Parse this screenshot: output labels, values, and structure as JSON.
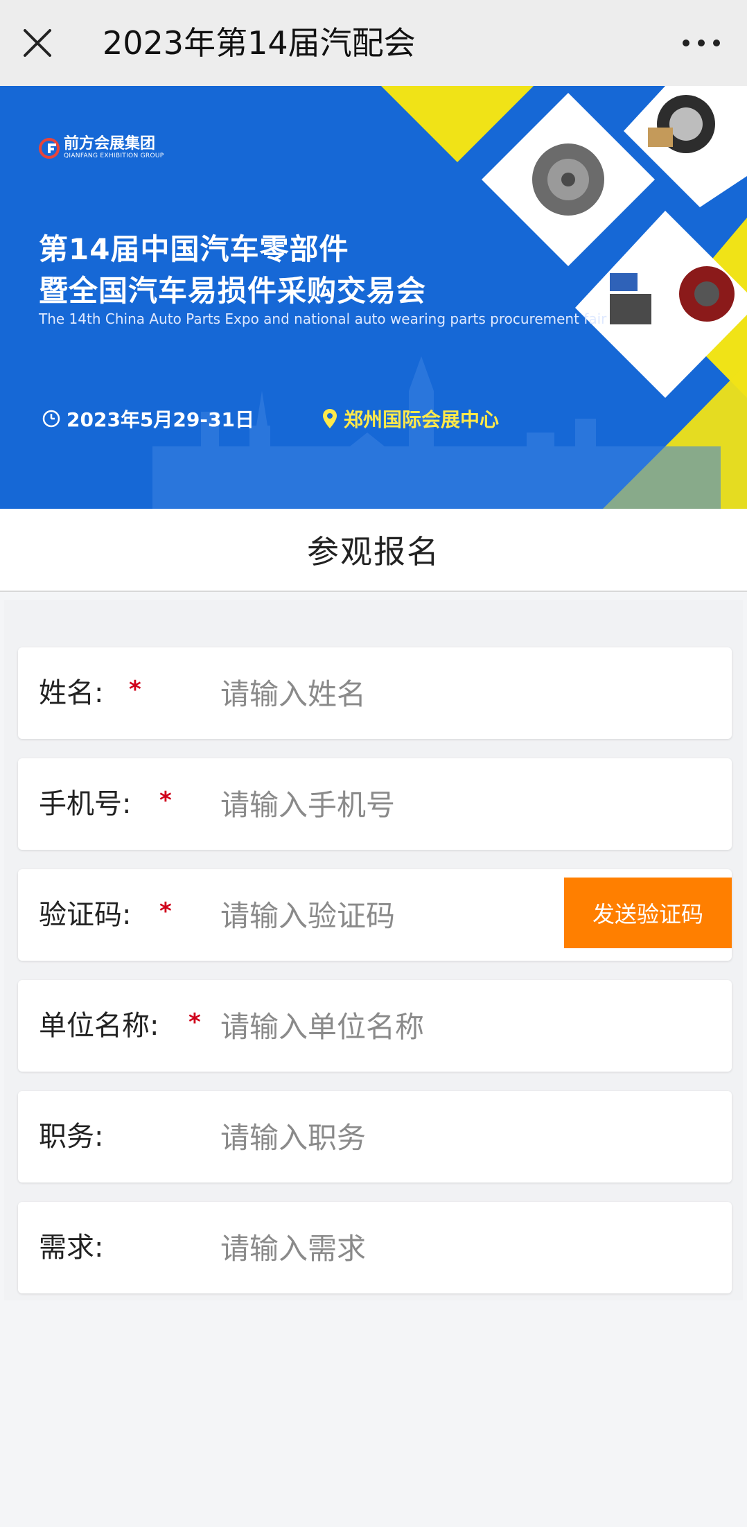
{
  "topbar": {
    "title": "2023年第14届汽配会",
    "close_icon": "close-icon",
    "more_icon": "more-dots-icon"
  },
  "banner": {
    "logo_cn": "前方会展集团",
    "logo_en": "QIANFANG EXHIBITION GROUP",
    "title_line1": "第14届中国汽车零部件",
    "title_line2": "暨全国汽车易损件采购交易会",
    "subtitle": "The 14th China Auto Parts Expo and national auto wearing parts procurement fair",
    "date": "2023年5月29-31日",
    "location": "郑州国际会展中心",
    "colors": {
      "background": "#1668d6",
      "accent_yellow": "#f0e317",
      "location_text": "#ffe94a"
    }
  },
  "section": {
    "title": "参观报名"
  },
  "form": {
    "fields": [
      {
        "label": "姓名:",
        "required": true,
        "placeholder": "请输入姓名"
      },
      {
        "label": "手机号:",
        "required": true,
        "placeholder": "请输入手机号"
      },
      {
        "label": "验证码:",
        "required": true,
        "placeholder": "请输入验证码"
      },
      {
        "label": "单位名称:",
        "required": true,
        "placeholder": "请输入单位名称"
      },
      {
        "label": "职务:",
        "required": false,
        "placeholder": "请输入职务"
      },
      {
        "label": "需求:",
        "required": false,
        "placeholder": "请输入需求"
      }
    ],
    "required_mark": "*",
    "send_code_label": "发送验证码",
    "send_code_color": "#ff7f00"
  }
}
